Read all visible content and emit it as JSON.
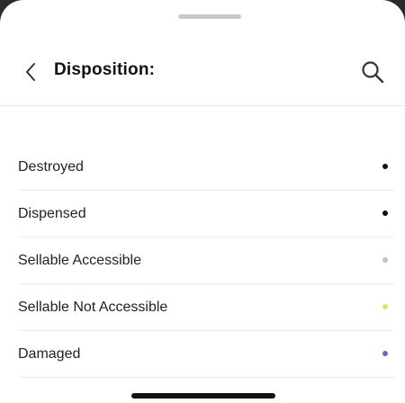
{
  "header": {
    "title": "Disposition:"
  },
  "icons": {
    "back": "chevron-left-icon",
    "search": "search-icon"
  },
  "dispositions": [
    {
      "label": "Destroyed",
      "color": "#111111"
    },
    {
      "label": "Dispensed",
      "color": "#111111"
    },
    {
      "label": "Sellable Accessible",
      "color": "#c3c3bc"
    },
    {
      "label": "Sellable Not Accessible",
      "color": "#d8e663"
    },
    {
      "label": "Damaged",
      "color": "#8d57c7"
    }
  ]
}
